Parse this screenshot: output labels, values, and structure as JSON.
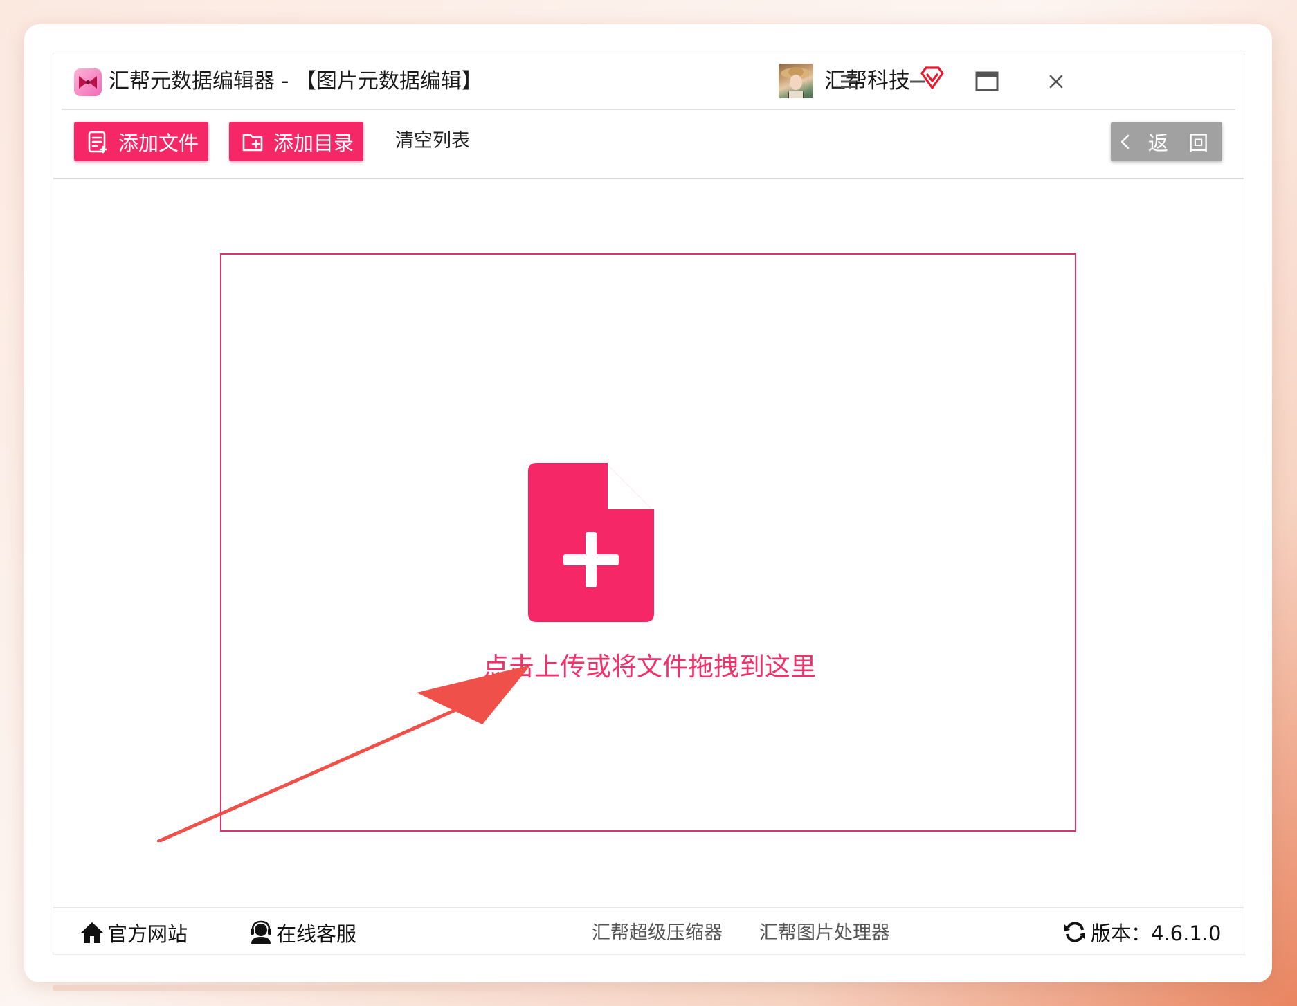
{
  "app": {
    "title": "汇帮元数据编辑器 - 【图片元数据编辑】",
    "user_name": "汇帮科技"
  },
  "toolbar": {
    "add_file_label": "添加文件",
    "add_folder_label": "添加目录",
    "clear_label": "清空列表",
    "back_label": "返 回"
  },
  "dropzone": {
    "hint": "点击上传或将文件拖拽到这里"
  },
  "footer": {
    "website_label": "官方网站",
    "support_label": "在线客服",
    "app1_label": "汇帮超级压缩器",
    "app2_label": "汇帮图片处理器",
    "version_label": "版本：4.6.1.0"
  },
  "colors": {
    "accent": "#f52766",
    "back_button": "#a1a1a1",
    "annotation_arrow": "#f0504a"
  },
  "icons": {
    "logo": "bowtie-logo-icon",
    "vip": "vip-diamond-icon",
    "menu": "hamburger-menu-icon",
    "minimize": "minimize-icon",
    "maximize": "maximize-icon",
    "close": "close-icon",
    "add_file": "add-file-icon",
    "add_folder": "add-folder-icon",
    "back": "chevron-left-icon",
    "upload": "file-plus-icon",
    "home": "home-icon",
    "support": "headset-user-icon",
    "refresh": "refresh-icon"
  }
}
